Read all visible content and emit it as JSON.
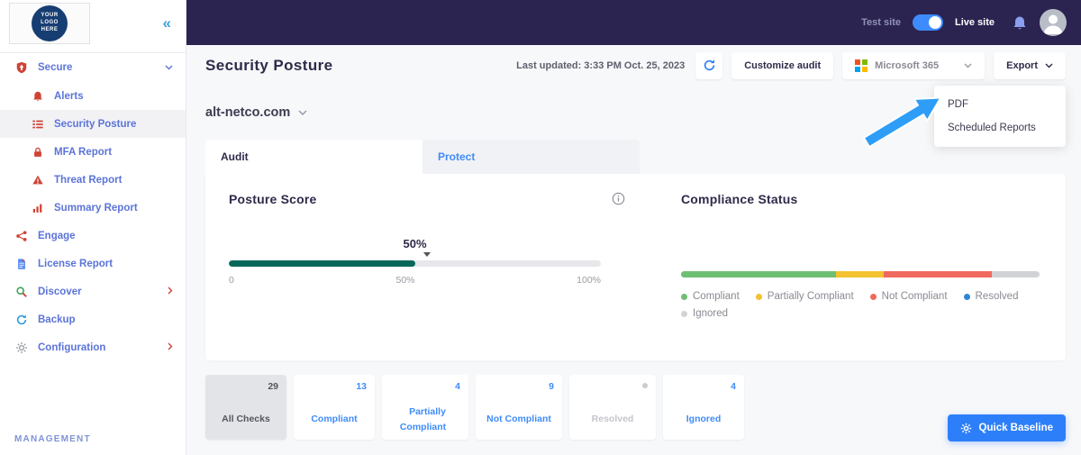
{
  "colors": {
    "topbar_bg": "#2b2350",
    "accent_blue": "#2d7ff9",
    "sidebar_text": "#5b74d8",
    "icon_red": "#cf4436",
    "posture_fill": "#07685a"
  },
  "topbar": {
    "test_site": "Test site",
    "live_site": "Live site"
  },
  "sidebar": {
    "logo_line1": "YOUR",
    "logo_line2": "LOGO",
    "logo_line3": "HERE",
    "management": "MANAGEMENT",
    "items": [
      {
        "label": "Secure"
      },
      {
        "label": "Alerts"
      },
      {
        "label": "Security Posture"
      },
      {
        "label": "MFA Report"
      },
      {
        "label": "Threat Report"
      },
      {
        "label": "Summary Report"
      },
      {
        "label": "Engage"
      },
      {
        "label": "License Report"
      },
      {
        "label": "Discover"
      },
      {
        "label": "Backup"
      },
      {
        "label": "Configuration"
      }
    ]
  },
  "header": {
    "title": "Security Posture",
    "last_updated": "Last updated: 3:33 PM Oct. 25, 2023",
    "customize_audit": "Customize audit",
    "tenant": "Microsoft 365",
    "export": "Export"
  },
  "export_menu": {
    "items": [
      {
        "label": "PDF"
      },
      {
        "label": "Scheduled Reports"
      }
    ]
  },
  "content": {
    "domain": "alt-netco.com",
    "tabs": [
      {
        "label": "Audit"
      },
      {
        "label": "Protect"
      }
    ],
    "posture": {
      "title": "Posture Score",
      "score": "50%",
      "fill_width": "50%",
      "scale_min": "0",
      "scale_mid": "50%",
      "scale_max": "100%"
    },
    "compliance": {
      "title": "Compliance Status",
      "segments": [
        {
          "label": "Compliant",
          "color": "#6fbf73",
          "width": "43.3%"
        },
        {
          "label": "Partially Compliant",
          "color": "#f2c230",
          "width": "13.3%"
        },
        {
          "label": "Not Compliant",
          "color": "#f0695f",
          "width": "30%"
        },
        {
          "label": "Resolved",
          "color": "#2f86d6",
          "width": "0%"
        },
        {
          "label": "Ignored",
          "color": "#d2d3d6",
          "width": "13.4%"
        }
      ],
      "legend": [
        {
          "label": "Compliant",
          "color": "#6fbf73"
        },
        {
          "label": "Partially Compliant",
          "color": "#f2c230"
        },
        {
          "label": "Not Compliant",
          "color": "#f0695f"
        },
        {
          "label": "Resolved",
          "color": "#2f86d6"
        },
        {
          "label": "Ignored",
          "color": "#d2d3d6"
        }
      ]
    },
    "stats": [
      {
        "value": "29",
        "label": "All Checks"
      },
      {
        "value": "13",
        "label": "Compliant"
      },
      {
        "value": "4",
        "label": "Partially Compliant"
      },
      {
        "value": "9",
        "label": "Not Compliant"
      },
      {
        "value": "",
        "label": "Resolved"
      },
      {
        "value": "4",
        "label": "Ignored"
      }
    ],
    "quick_baseline": "Quick Baseline"
  }
}
